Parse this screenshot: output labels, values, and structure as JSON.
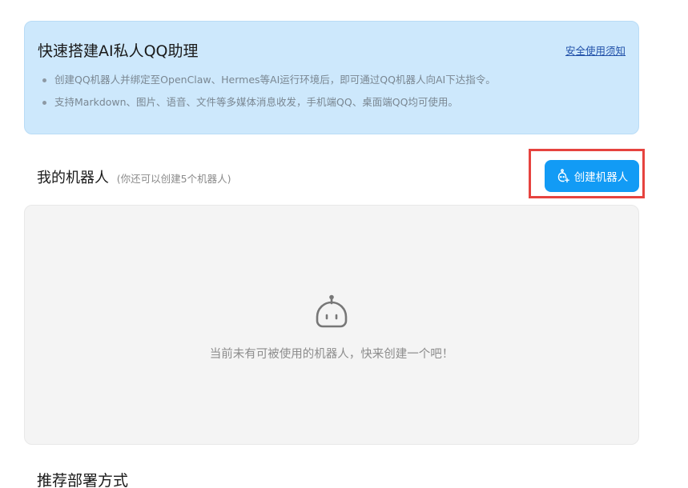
{
  "intro": {
    "title": "快速搭建AI私人QQ助理",
    "link": "安全使用须知",
    "bullets": [
      "创建QQ机器人并绑定至OpenClaw、Hermes等AI运行环境后，即可通过QQ机器人向AI下达指令。",
      "支持Markdown、图片、语音、文件等多媒体消息收发，手机端QQ、桌面端QQ均可使用。"
    ]
  },
  "my_bots": {
    "title": "我的机器人",
    "note": "(你还可以创建5个机器人)",
    "create_button": "创建机器人",
    "create_button_icon": "add-robot-icon",
    "empty_icon": "robot-icon",
    "empty_text": "当前未有可被使用的机器人，快来创建一个吧！"
  },
  "deploy": {
    "title": "推荐部署方式"
  },
  "colors": {
    "banner_bg": "#cde8fc",
    "primary_button": "#129bf5",
    "highlight_frame": "#e6433f",
    "empty_bg": "#f4f4f4"
  }
}
